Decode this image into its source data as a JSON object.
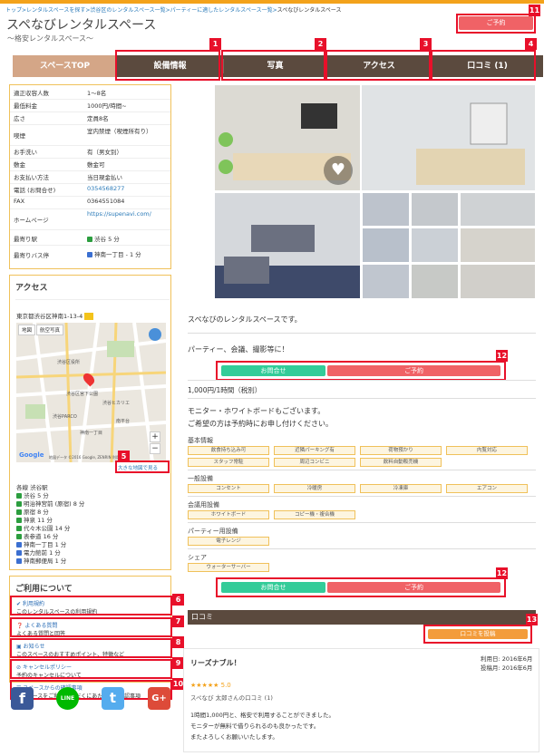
{
  "breadcrumb": {
    "items": [
      "トップ",
      "レンタルスペースを探す",
      "渋谷区のレンタルスペース一覧",
      "パーティーに適したレンタルスペース一覧"
    ],
    "separator": ">",
    "current": "スペなびレンタルスペース"
  },
  "header": {
    "title": "スペなびレンタルスペース",
    "subtitle": "～格安レンタルスペース～",
    "reserve_label": "ご予約"
  },
  "nav": {
    "tabs": [
      {
        "label": "スペースTOP",
        "active": true
      },
      {
        "label": "設備情報",
        "active": false
      },
      {
        "label": "写真",
        "active": false
      },
      {
        "label": "アクセス",
        "active": false
      },
      {
        "label": "口コミ (1)",
        "active": false
      }
    ]
  },
  "annotations": [
    "1",
    "2",
    "3",
    "4",
    "5",
    "6",
    "7",
    "8",
    "9",
    "10",
    "11",
    "12",
    "12",
    "13"
  ],
  "info": {
    "rows": [
      {
        "key": "適正収容人数",
        "value": "1～8名"
      },
      {
        "key": "最低料金",
        "value": "1000円/時間~"
      },
      {
        "key": "広さ",
        "value": "定員8名"
      },
      {
        "key": "喫煙",
        "value": "室内禁煙（喫煙所有り）"
      },
      {
        "key": "お手洗い",
        "value": "有（男女別）"
      },
      {
        "key": "敷金",
        "value": "敷金可"
      },
      {
        "key": "お支払い方法",
        "value": "当日現金払い"
      },
      {
        "key": "電話 (お問合せ)",
        "value": "0354568277"
      },
      {
        "key": "FAX",
        "value": "0364551084"
      },
      {
        "key": "ホームページ",
        "value": "https://supenavi.com/"
      },
      {
        "key": "最寄り駅",
        "value": "渋谷 5 分"
      },
      {
        "key": "最寄りバス停",
        "value": "神南一丁目 - 1 分"
      }
    ]
  },
  "access": {
    "heading": "アクセス",
    "address": "東京都渋谷区神南1-13-4",
    "map_tabs": [
      "地図",
      "航空写真"
    ],
    "map_labels": [
      "渋谷区役所",
      "渋谷ヒカリエ",
      "渋谷PARCO",
      "渋谷区宮下公園",
      "神南一丁目",
      "南平台"
    ],
    "map_footer": "地図データ ©2016 Google, ZENRIN  利用規約",
    "google": "Google",
    "enlarge_link": "大きな地図で見る",
    "stations_heading": "各線  渋谷駅",
    "stations": [
      {
        "name": "渋谷 5 分",
        "type": "train"
      },
      {
        "name": "明治神宮前 (原宿) 8 分",
        "type": "train"
      },
      {
        "name": "原宿 8 分",
        "type": "train"
      },
      {
        "name": "神泉 11 分",
        "type": "train"
      },
      {
        "name": "代々木公園 14 分",
        "type": "train"
      },
      {
        "name": "表参道 16 分",
        "type": "train"
      },
      {
        "name": "神南一丁目 1 分",
        "type": "bus"
      },
      {
        "name": "電力館前 1 分",
        "type": "bus"
      },
      {
        "name": "神南郵便局 1 分",
        "type": "bus"
      }
    ]
  },
  "usage": {
    "heading": "ご利用について",
    "items": [
      {
        "title": "利用規約",
        "desc": "このレンタルスペースの利用規約"
      },
      {
        "title": "よくある質問",
        "desc": "よくある質問と回答"
      },
      {
        "title": "お知らせ",
        "desc": "このスペースのおすすめポイント、特徴など"
      },
      {
        "title": "キャンセルポリシー",
        "desc": "予約のキャンセルについて"
      },
      {
        "title": "スペースからの確認事項",
        "desc": "本スペースをご利用いただくにあたっての確認事項"
      }
    ]
  },
  "social": [
    "f",
    "LINE",
    "t",
    "G+"
  ],
  "main": {
    "intro": "スペなびのレンタルスペースです。",
    "catch": "パーティー、会議、撮影等に！",
    "inquiry_label": "お問合せ",
    "reserve_label": "ご予約",
    "price": "1,000円/1時間（税別）",
    "desc1": "モニター・ホワイトボードもございます。",
    "desc2": "ご希望の方は予約時にお申し付けください。",
    "groups": [
      {
        "name": "基本情報",
        "tags": [
          "飲食持ち込み可",
          "近隣パーキング有",
          "荷物預かり",
          "内覧対応",
          "スタッフ常駐",
          "周辺コンビニ",
          "飲料自動販売機"
        ]
      },
      {
        "name": "一般設備",
        "tags": [
          "コンセント",
          "冷暖房",
          "冷凍庫",
          "エアコン"
        ]
      },
      {
        "name": "会議用設備",
        "tags": [
          "ホワイトボード",
          "コピー機・複合機"
        ]
      },
      {
        "name": "パーティー用設備",
        "tags": [
          "電子レンジ"
        ]
      },
      {
        "name": "シェア",
        "tags": [
          "ウォーターサーバー"
        ]
      }
    ]
  },
  "reviews": {
    "heading": "口コミ",
    "post_label": "口コミを投稿",
    "title": "リーズナブル！",
    "stars": "★★★★★",
    "score": "5.0",
    "author": "スペなび 太郎さんの口コミ (1)",
    "used_date": "利用日: 2016年6月",
    "posted_date": "投稿月: 2016年6月",
    "body": [
      "1時間1,000円と、格安で利用することができました。",
      "モニターが無料で借りられるのも良かったです。",
      "またよろしくお願いいたします。"
    ]
  },
  "colors": {
    "accent": "#f3a21b",
    "nav": "#5b4a3e",
    "red": "#f06266",
    "green": "#33cc99",
    "annot": "#e8102a"
  }
}
